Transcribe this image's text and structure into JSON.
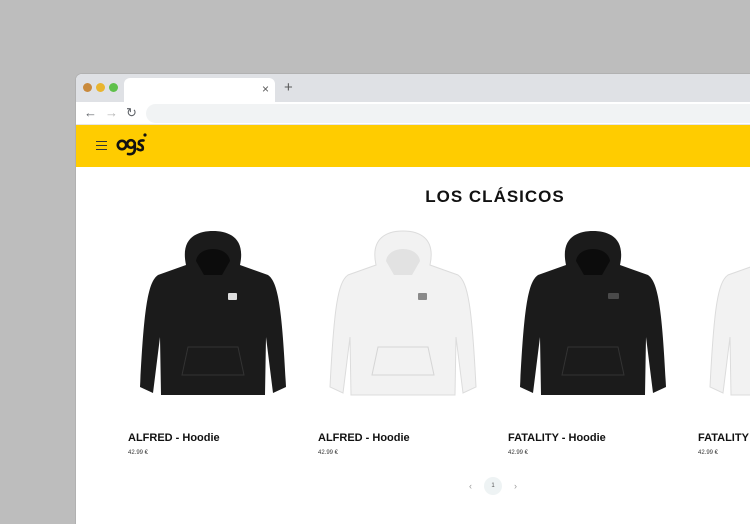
{
  "browser": {
    "tab_close": "×",
    "new_tab": "+",
    "back": "←",
    "forward": "→",
    "reload": "↻"
  },
  "header": {
    "logo_text": "ogs",
    "brand_color": "#ffcc00"
  },
  "page": {
    "title": "LOS CLÁSICOS"
  },
  "products": [
    {
      "name": "ALFRED - Hoodie",
      "price": "42.99 €",
      "color": "black"
    },
    {
      "name": "ALFRED - Hoodie",
      "price": "42.99 €",
      "color": "white"
    },
    {
      "name": "FATALITY - Hoodie",
      "price": "42.99 €",
      "color": "black"
    },
    {
      "name": "FATALITY - Hoodie",
      "price": "42.99 €",
      "color": "white"
    }
  ],
  "pagination": {
    "prev": "‹",
    "current": "1",
    "next": "›"
  }
}
